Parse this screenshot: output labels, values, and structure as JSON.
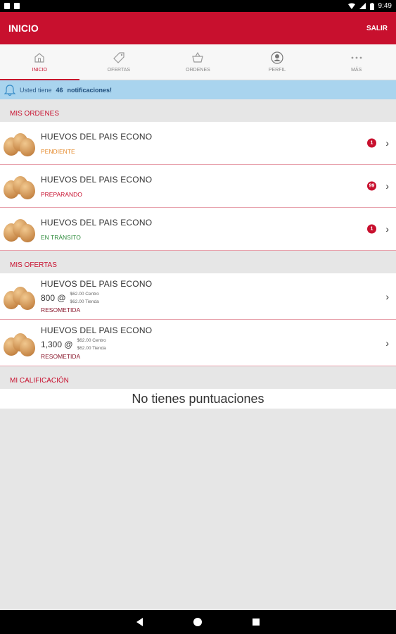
{
  "statusbar": {
    "time": "9:49"
  },
  "appbar": {
    "title": "INICIO",
    "action": "SALIR"
  },
  "tabs": [
    {
      "label": "INICIO",
      "icon": "home-icon"
    },
    {
      "label": "OFERTAS",
      "icon": "tag-icon"
    },
    {
      "label": "ORDENES",
      "icon": "basket-icon"
    },
    {
      "label": "Perfil",
      "icon": "profile-icon"
    },
    {
      "label": "MÁS",
      "icon": "more-icon"
    }
  ],
  "notification": {
    "prefix": "Usted tiene",
    "count": "46",
    "suffix": "notificaciones!"
  },
  "orders": {
    "title": "MIS ORDENES",
    "items": [
      {
        "name": "HUEVOS DEL PAIS ECONO",
        "status": "PENDIENTE",
        "badge": "1"
      },
      {
        "name": "HUEVOS DEL PAIS ECONO",
        "status": "PREPARANDO",
        "badge": "99"
      },
      {
        "name": "HUEVOS DEL PAIS ECONO",
        "status": "EN TRÁNSITO",
        "badge": "1"
      }
    ]
  },
  "offers": {
    "title": "MIS OFERTAS",
    "items": [
      {
        "name": "HUEVOS DEL PAIS ECONO",
        "qty": "800 @",
        "price_center": "$62.00 Centro",
        "price_store": "$62.00 Tienda",
        "status": "RESOMETIDA"
      },
      {
        "name": "HUEVOS DEL PAIS ECONO",
        "qty": "1,300 @",
        "price_center": "$62.00 Centro",
        "price_store": "$62.00 Tienda",
        "status": "RESOMETIDA"
      }
    ]
  },
  "rating": {
    "title": "MI CALIFICACIÓN",
    "empty_text": "No tienes puntuaciones"
  },
  "colors": {
    "primary": "#c8102e",
    "notif_bg": "#a9d4ee"
  }
}
